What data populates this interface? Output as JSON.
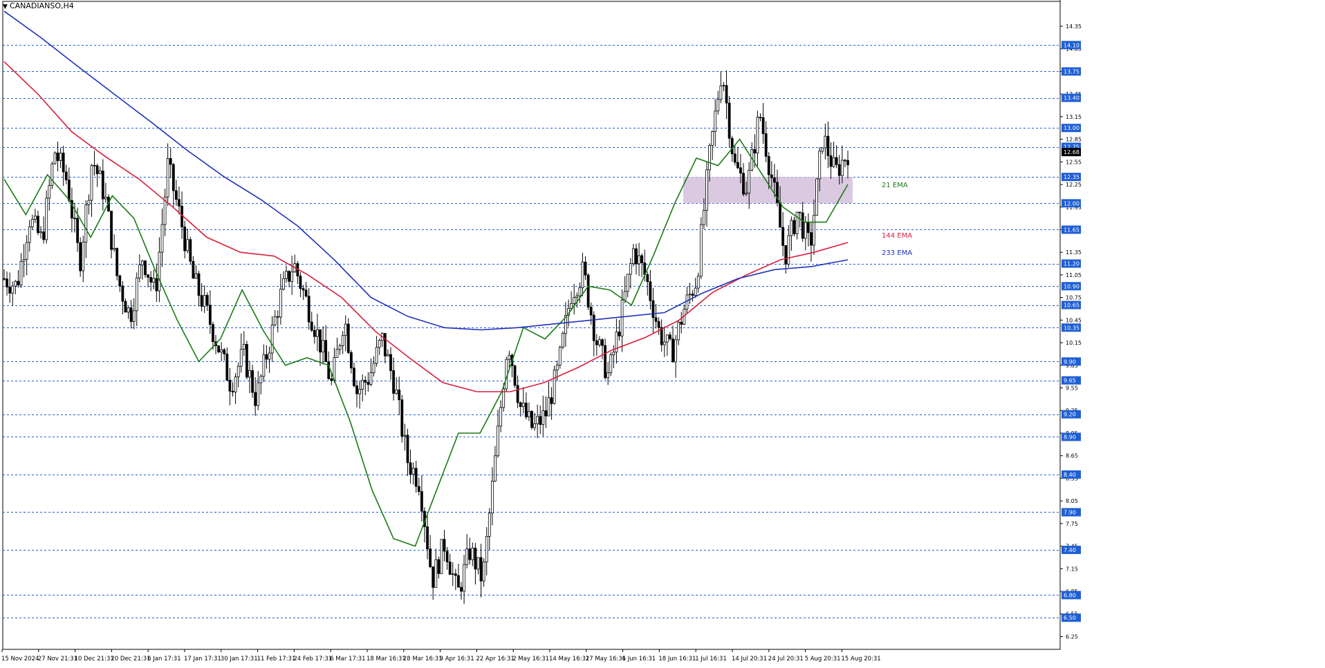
{
  "chart_data": {
    "type": "candlestick",
    "title": "CANADIANSO,H4",
    "last_price": "12.68",
    "price_axis": {
      "ylim": [
        6.08,
        14.57
      ],
      "ticks": [
        6.25,
        6.55,
        6.85,
        7.15,
        7.45,
        7.75,
        8.05,
        8.35,
        8.65,
        8.95,
        9.25,
        9.55,
        9.85,
        10.15,
        10.45,
        10.75,
        11.05,
        11.35,
        11.65,
        11.95,
        12.25,
        12.55,
        12.85,
        13.15,
        13.45,
        13.75,
        14.05,
        14.35
      ],
      "tick_labels": [
        "6.25",
        "6.55",
        "6.85",
        "7.15",
        "7.45",
        "7.75",
        "8.05",
        "8.35",
        "8.65",
        "8.95",
        "9.25",
        "9.55",
        "9.85",
        "10.15",
        "10.45",
        "10.75",
        "11.05",
        "11.35",
        "11.65",
        "11.95",
        "12.25",
        "12.55",
        "12.85",
        "13.15",
        "13.45",
        "13.75",
        "14.05",
        "14.35"
      ]
    },
    "levels": [
      {
        "value": 14.1,
        "label": "14.10"
      },
      {
        "value": 13.75,
        "label": "13.75"
      },
      {
        "value": 13.4,
        "label": "13.40"
      },
      {
        "value": 13.0,
        "label": "13.00"
      },
      {
        "value": 12.75,
        "label": "12.75"
      },
      {
        "value": 12.35,
        "label": "12.35"
      },
      {
        "value": 12.0,
        "label": "12.00"
      },
      {
        "value": 11.65,
        "label": "11.65"
      },
      {
        "value": 11.2,
        "label": "11.20"
      },
      {
        "value": 10.9,
        "label": "10.90"
      },
      {
        "value": 10.65,
        "label": "10.65"
      },
      {
        "value": 10.35,
        "label": "10.35"
      },
      {
        "value": 9.9,
        "label": "9.90"
      },
      {
        "value": 9.65,
        "label": "9.65"
      },
      {
        "value": 9.2,
        "label": "9.20"
      },
      {
        "value": 8.9,
        "label": "8.90"
      },
      {
        "value": 8.4,
        "label": "8.40"
      },
      {
        "value": 7.9,
        "label": "7.90"
      },
      {
        "value": 7.4,
        "label": "7.40"
      },
      {
        "value": 6.8,
        "label": "6.80"
      },
      {
        "value": 6.5,
        "label": "6.50"
      }
    ],
    "zone": {
      "from_date": "1 Jul",
      "to_date": "15 Aug",
      "low": 12.0,
      "high": 12.35,
      "color": "#d7c3df"
    },
    "time_axis": {
      "labels": [
        "15 Nov 2024",
        "27 Nov 21:31",
        "10 Dec 21:31",
        "20 Dec 21:31",
        "6 Jan 17:31",
        "17 Jan 17:31",
        "30 Jan 17:31",
        "11 Feb 17:31",
        "24 Feb 17:31",
        "6 Mar 17:31",
        "18 Mar 16:31",
        "28 Mar 16:31",
        "9 Apr 16:31",
        "22 Apr 16:31",
        "2 May 16:31",
        "14 May 16:31",
        "27 May 16:31",
        "6 Jun 16:31",
        "18 Jun 16:31",
        "1 Jul 16:31",
        "14 Jul 20:31",
        "24 Jul 20:31",
        "5 Aug 20:31",
        "15 Aug 20:31"
      ]
    },
    "price_path": [
      [
        0,
        11.0
      ],
      [
        1,
        10.9
      ],
      [
        2,
        11.8
      ],
      [
        3,
        11.5
      ],
      [
        4,
        12.7
      ],
      [
        5,
        12.3
      ],
      [
        6,
        11.2
      ],
      [
        7,
        12.6
      ],
      [
        8,
        12.1
      ],
      [
        9,
        11.0
      ],
      [
        10,
        10.5
      ],
      [
        11,
        11.3
      ],
      [
        12,
        10.8
      ],
      [
        13,
        12.5
      ],
      [
        14,
        11.8
      ],
      [
        15,
        11.0
      ],
      [
        16,
        10.6
      ],
      [
        17,
        10.1
      ],
      [
        18,
        9.6
      ],
      [
        19,
        10.0
      ],
      [
        20,
        9.4
      ],
      [
        21,
        10.1
      ],
      [
        22,
        10.8
      ],
      [
        23,
        11.2
      ],
      [
        24,
        10.7
      ],
      [
        25,
        10.2
      ],
      [
        26,
        9.6
      ],
      [
        27,
        10.5
      ],
      [
        28,
        9.5
      ],
      [
        29,
        9.7
      ],
      [
        30,
        10.2
      ],
      [
        31,
        9.6
      ],
      [
        32,
        8.6
      ],
      [
        33,
        8.3
      ],
      [
        34,
        7.0
      ],
      [
        35,
        7.5
      ],
      [
        36,
        6.8
      ],
      [
        37,
        7.4
      ],
      [
        38,
        7.0
      ],
      [
        39,
        8.6
      ],
      [
        40,
        10.2
      ],
      [
        41,
        9.3
      ],
      [
        42,
        9.0
      ],
      [
        43,
        9.2
      ],
      [
        44,
        9.8
      ],
      [
        45,
        10.8
      ],
      [
        46,
        11.1
      ],
      [
        47,
        10.2
      ],
      [
        48,
        9.7
      ],
      [
        49,
        10.5
      ],
      [
        50,
        11.4
      ],
      [
        51,
        11.0
      ],
      [
        52,
        10.3
      ],
      [
        53,
        10.0
      ],
      [
        54,
        10.6
      ],
      [
        55,
        11.0
      ],
      [
        56,
        12.6
      ],
      [
        57,
        13.8
      ],
      [
        58,
        12.5
      ],
      [
        59,
        12.2
      ],
      [
        60,
        13.2
      ],
      [
        61,
        12.3
      ],
      [
        62,
        11.3
      ],
      [
        63,
        11.9
      ],
      [
        64,
        11.4
      ],
      [
        65,
        12.9
      ],
      [
        66,
        12.4
      ],
      [
        67,
        12.68
      ]
    ],
    "price_path_note": "",
    "series": [
      {
        "name": "21 EMA",
        "color": "#1a7a14",
        "label_value": 12.25,
        "points": [
          [
            0,
            12.32
          ],
          [
            1,
            11.85
          ],
          [
            2,
            12.38
          ],
          [
            3,
            12.05
          ],
          [
            4,
            11.55
          ],
          [
            5,
            12.1
          ],
          [
            6,
            11.8
          ],
          [
            7,
            11.1
          ],
          [
            8,
            10.45
          ],
          [
            9,
            9.9
          ],
          [
            10,
            10.2
          ],
          [
            11,
            10.85
          ],
          [
            12,
            10.3
          ],
          [
            13,
            9.85
          ],
          [
            14,
            9.95
          ],
          [
            15,
            9.85
          ],
          [
            16,
            9.1
          ],
          [
            17,
            8.2
          ],
          [
            18,
            7.55
          ],
          [
            19,
            7.45
          ],
          [
            20,
            8.2
          ],
          [
            21,
            8.95
          ],
          [
            22,
            8.95
          ],
          [
            23,
            9.5
          ],
          [
            24,
            10.35
          ],
          [
            25,
            10.2
          ],
          [
            26,
            10.5
          ],
          [
            27,
            10.9
          ],
          [
            28,
            10.85
          ],
          [
            29,
            10.65
          ],
          [
            30,
            11.3
          ],
          [
            31,
            12.0
          ],
          [
            32,
            12.6
          ],
          [
            33,
            12.5
          ],
          [
            34,
            12.85
          ],
          [
            35,
            12.4
          ],
          [
            36,
            11.95
          ],
          [
            37,
            11.75
          ],
          [
            38,
            11.75
          ],
          [
            39,
            12.25
          ]
        ]
      },
      {
        "name": "144 EMA",
        "color": "#d71e3a",
        "label_value": 11.58,
        "points": [
          [
            0,
            13.88
          ],
          [
            1,
            13.45
          ],
          [
            2,
            12.95
          ],
          [
            3,
            12.62
          ],
          [
            4,
            12.32
          ],
          [
            5,
            11.95
          ],
          [
            6,
            11.55
          ],
          [
            7,
            11.35
          ],
          [
            8,
            11.3
          ],
          [
            9,
            11.05
          ],
          [
            10,
            10.75
          ],
          [
            11,
            10.3
          ],
          [
            12,
            9.95
          ],
          [
            13,
            9.62
          ],
          [
            14,
            9.5
          ],
          [
            15,
            9.5
          ],
          [
            16,
            9.62
          ],
          [
            17,
            9.82
          ],
          [
            18,
            10.05
          ],
          [
            19,
            10.22
          ],
          [
            20,
            10.45
          ],
          [
            21,
            10.82
          ],
          [
            22,
            11.05
          ],
          [
            23,
            11.25
          ],
          [
            24,
            11.35
          ],
          [
            25,
            11.48
          ]
        ]
      },
      {
        "name": "233 EMA",
        "color": "#1f2fb8",
        "label_value": 11.35,
        "points": [
          [
            0,
            14.55
          ],
          [
            1,
            14.2
          ],
          [
            2,
            13.82
          ],
          [
            3,
            13.45
          ],
          [
            4,
            13.08
          ],
          [
            5,
            12.7
          ],
          [
            6,
            12.35
          ],
          [
            7,
            12.05
          ],
          [
            8,
            11.7
          ],
          [
            9,
            11.25
          ],
          [
            10,
            10.75
          ],
          [
            11,
            10.5
          ],
          [
            12,
            10.35
          ],
          [
            13,
            10.32
          ],
          [
            14,
            10.35
          ],
          [
            15,
            10.4
          ],
          [
            16,
            10.45
          ],
          [
            17,
            10.5
          ],
          [
            18,
            10.55
          ],
          [
            19,
            10.8
          ],
          [
            20,
            11.0
          ],
          [
            21,
            11.12
          ],
          [
            22,
            11.16
          ],
          [
            23,
            11.25
          ]
        ]
      }
    ],
    "grid": "horizontal dashed at levels",
    "legend": "inline labels right of series"
  }
}
